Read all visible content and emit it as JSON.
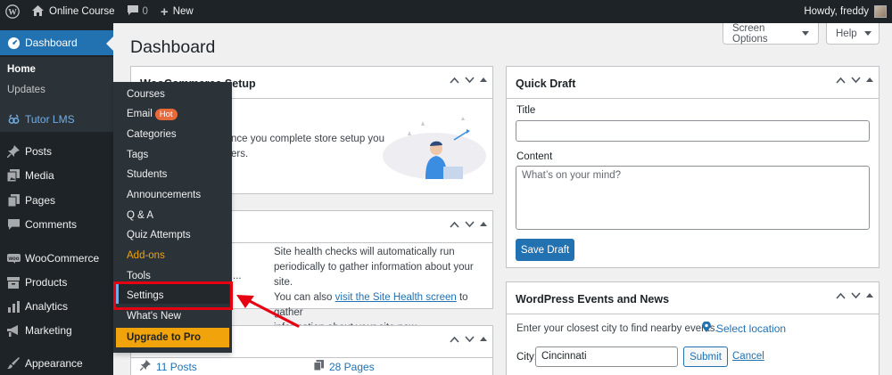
{
  "adminbar": {
    "site_name": "Online Course",
    "comments_count": "0",
    "new_label": "New",
    "howdy": "Howdy, freddy"
  },
  "sidebar": {
    "dashboard": "Dashboard",
    "home": "Home",
    "updates": "Updates",
    "tutor": "Tutor LMS",
    "posts": "Posts",
    "media": "Media",
    "pages": "Pages",
    "comments": "Comments",
    "woocommerce": "WooCommerce",
    "products": "Products",
    "analytics": "Analytics",
    "marketing": "Marketing",
    "appearance": "Appearance"
  },
  "flyout": {
    "courses": "Courses",
    "email": "Email",
    "hot": "Hot",
    "categories": "Categories",
    "tags": "Tags",
    "students": "Students",
    "announcements": "Announcements",
    "qa": "Q & A",
    "quiz": "Quiz Attempts",
    "addons": "Add-ons",
    "tools": "Tools",
    "settings": "Settings",
    "whats_new": "What's New",
    "upgrade": "Upgrade to Pro"
  },
  "header": {
    "title": "Dashboard",
    "screen_options": "Screen Options",
    "help": "Help"
  },
  "setup_box": {
    "title_fragment": "WooCommerce Setup",
    "text_line1": "nce you complete store setup you",
    "text_line2": "ers."
  },
  "health_box": {
    "line1": "Site health checks will automatically run",
    "line2": "periodically to gather information about your site.",
    "line3_pre": "You can also ",
    "line3_link": "visit the Site Health screen",
    "line3_post": " to gather",
    "line4": "information about your site now.",
    "ellipsis": "..."
  },
  "glance_box": {
    "posts": "11 Posts",
    "pages": "28 Pages"
  },
  "quick_draft": {
    "title": "Quick Draft",
    "title_label": "Title",
    "content_label": "Content",
    "content_placeholder": "What’s on your mind?",
    "save_label": "Save Draft"
  },
  "events": {
    "title": "WordPress Events and News",
    "intro": "Enter your closest city to find nearby events.",
    "select_location": "Select location",
    "city_label": "City:",
    "city_value": "Cincinnati",
    "submit": "Submit",
    "cancel": "Cancel"
  },
  "colors": {
    "admin_dark": "#1d2327",
    "accent_blue": "#2271b1",
    "highlight_red": "#e60012",
    "upgrade_orange": "#f0a30a"
  }
}
